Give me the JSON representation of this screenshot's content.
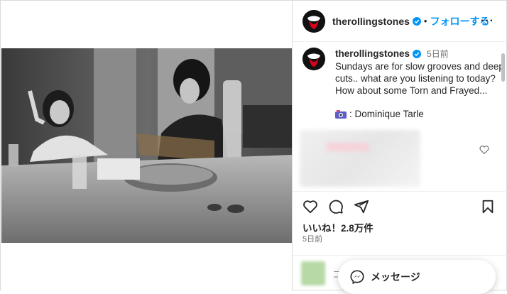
{
  "header": {
    "username": "therollingstones",
    "separator": "•",
    "follow_label": "フォローする",
    "more_label": "···"
  },
  "caption": {
    "username": "therollingstones",
    "time": "5日前",
    "text": "Sundays are for slow grooves and deep cuts.. what are you listening to today? How about some Torn and Frayed...",
    "credit": ": Dominique Tarle"
  },
  "actions": {
    "likes": "いいね！2.8万件",
    "date": "5日前"
  },
  "comment_box": {
    "placeholder_fragment": "コ"
  },
  "message_button": {
    "label": "メッセージ"
  },
  "colors": {
    "accent": "#0095f6",
    "text": "#262626",
    "muted": "#737373",
    "logo_red": "#d6001c"
  },
  "icons": [
    "verified-badge-icon",
    "more-icon",
    "camera-emoji-icon",
    "heart-icon",
    "comment-icon",
    "share-icon",
    "bookmark-icon",
    "messenger-icon",
    "tongue-logo-icon"
  ]
}
